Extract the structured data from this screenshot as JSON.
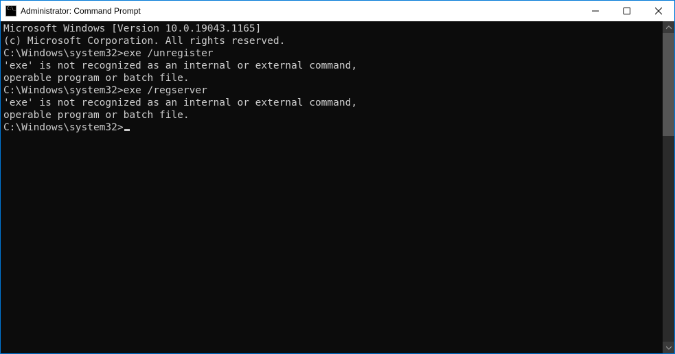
{
  "window": {
    "title": "Administrator: Command Prompt"
  },
  "terminal": {
    "lines": [
      "Microsoft Windows [Version 10.0.19043.1165]",
      "(c) Microsoft Corporation. All rights reserved.",
      "",
      "C:\\Windows\\system32>exe /unregister",
      "'exe' is not recognized as an internal or external command,",
      "operable program or batch file.",
      "",
      "C:\\Windows\\system32>exe /regserver",
      "'exe' is not recognized as an internal or external command,",
      "operable program or batch file.",
      "",
      "C:\\Windows\\system32>"
    ]
  }
}
